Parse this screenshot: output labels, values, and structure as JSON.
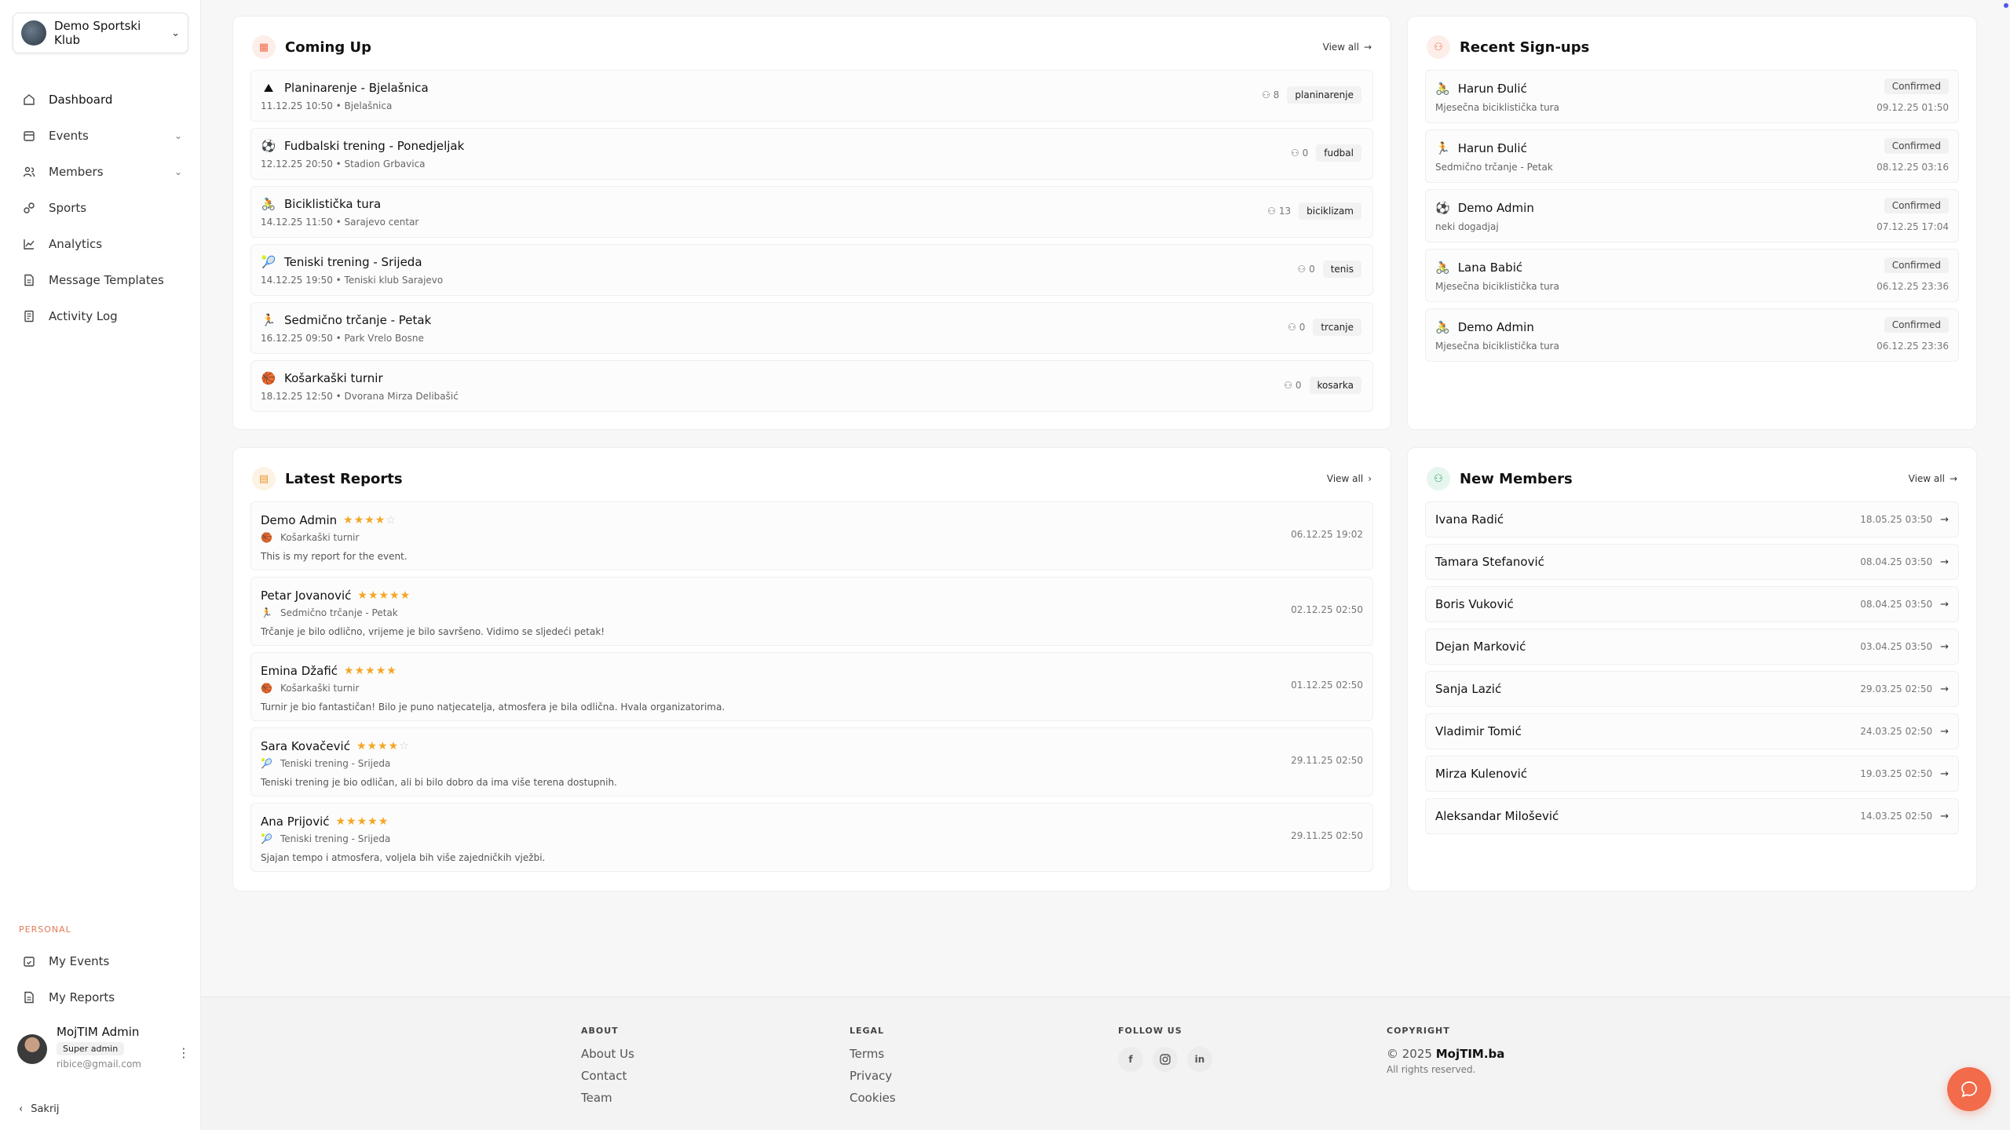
{
  "sidebar": {
    "club_name": "Demo Sportski Klub",
    "nav": [
      {
        "label": "Dashboard",
        "icon": "home-icon",
        "expandable": false
      },
      {
        "label": "Events",
        "icon": "calendar-icon",
        "expandable": true
      },
      {
        "label": "Members",
        "icon": "users-icon",
        "expandable": true
      },
      {
        "label": "Sports",
        "icon": "sports-icon",
        "expandable": false
      },
      {
        "label": "Analytics",
        "icon": "chart-icon",
        "expandable": false
      },
      {
        "label": "Message Templates",
        "icon": "document-icon",
        "expandable": false
      },
      {
        "label": "Activity Log",
        "icon": "log-icon",
        "expandable": false
      }
    ],
    "personal_label": "PERSONAL",
    "personal_nav": [
      {
        "label": "My Events",
        "icon": "calendar-check-icon"
      },
      {
        "label": "My Reports",
        "icon": "document-icon"
      }
    ],
    "user": {
      "name": "MojTIM Admin",
      "role": "Super admin",
      "email": "ribice@gmail.com"
    },
    "collapse_label": "Sakrij"
  },
  "coming_up": {
    "title": "Coming Up",
    "view_all": "View all",
    "events": [
      {
        "emoji": "⛰",
        "title": "Planinarenje - Bjelašnica",
        "sub": "11.12.25 10:50 • Bjelašnica",
        "count": "8",
        "tag": "planinarenje"
      },
      {
        "emoji": "⚽",
        "title": "Fudbalski trening - Ponedjeljak",
        "sub": "12.12.25 20:50 • Stadion Grbavica",
        "count": "0",
        "tag": "fudbal"
      },
      {
        "emoji": "🚴",
        "title": "Biciklistička tura",
        "sub": "14.12.25 11:50 • Sarajevo centar",
        "count": "13",
        "tag": "biciklizam"
      },
      {
        "emoji": "🎾",
        "title": "Teniski trening - Srijeda",
        "sub": "14.12.25 19:50 • Teniski klub Sarajevo",
        "count": "0",
        "tag": "tenis"
      },
      {
        "emoji": "🏃",
        "title": "Sedmično trčanje - Petak",
        "sub": "16.12.25 09:50 • Park Vrelo Bosne",
        "count": "0",
        "tag": "trcanje"
      },
      {
        "emoji": "🏀",
        "title": "Košarkaški turnir",
        "sub": "18.12.25 12:50 • Dvorana Mirza Delibašić",
        "count": "0",
        "tag": "kosarka"
      }
    ]
  },
  "recent_signups": {
    "title": "Recent Sign-ups",
    "items": [
      {
        "emoji": "🚴",
        "name": "Harun Đulić",
        "event": "Mjesečna biciklistička tura",
        "status": "Confirmed",
        "date": "09.12.25 01:50"
      },
      {
        "emoji": "🏃",
        "name": "Harun Đulić",
        "event": "Sedmično trčanje - Petak",
        "status": "Confirmed",
        "date": "08.12.25 03:16"
      },
      {
        "emoji": "⚽",
        "name": "Demo Admin",
        "event": "neki dogadjaj",
        "status": "Confirmed",
        "date": "07.12.25 17:04"
      },
      {
        "emoji": "🚴",
        "name": "Lana Babić",
        "event": "Mjesečna biciklistička tura",
        "status": "Confirmed",
        "date": "06.12.25 23:36"
      },
      {
        "emoji": "🚴",
        "name": "Demo Admin",
        "event": "Mjesečna biciklistička tura",
        "status": "Confirmed",
        "date": "06.12.25 23:36"
      }
    ]
  },
  "latest_reports": {
    "title": "Latest Reports",
    "view_all": "View all",
    "items": [
      {
        "name": "Demo Admin",
        "stars": "★★★★",
        "stars_off": "☆",
        "rating": 4,
        "emoji": "🏀",
        "event": "Košarkaški turnir",
        "text": "This is my report for the event.",
        "date": "06.12.25 19:02"
      },
      {
        "name": "Petar Jovanović",
        "stars": "★★★★★",
        "stars_off": "",
        "rating": 5,
        "emoji": "🏃",
        "event": "Sedmično trčanje - Petak",
        "text": "Trčanje je bilo odlično, vrijeme je bilo savršeno. Vidimo se sljedeći petak!",
        "date": "02.12.25 02:50"
      },
      {
        "name": "Emina Džafić",
        "stars": "★★★★★",
        "stars_off": "",
        "rating": 5,
        "emoji": "🏀",
        "event": "Košarkaški turnir",
        "text": "Turnir je bio fantastičan! Bilo je puno natjecatelja, atmosfera je bila odlična. Hvala organizatorima.",
        "date": "01.12.25 02:50"
      },
      {
        "name": "Sara Kovačević",
        "stars": "★★★★",
        "stars_off": "☆",
        "rating": 4,
        "emoji": "🎾",
        "event": "Teniski trening - Srijeda",
        "text": "Teniski trening je bio odličan, ali bi bilo dobro da ima više terena dostupnih.",
        "date": "29.11.25 02:50"
      },
      {
        "name": "Ana Prijović",
        "stars": "★★★★★",
        "stars_off": "",
        "rating": 5,
        "emoji": "🎾",
        "event": "Teniski trening - Srijeda",
        "text": "Sjajan tempo i atmosfera, voljela bih više zajedničkih vježbi.",
        "date": "29.11.25 02:50"
      }
    ]
  },
  "new_members": {
    "title": "New Members",
    "view_all": "View all",
    "items": [
      {
        "name": "Ivana Radić",
        "date": "18.05.25 03:50"
      },
      {
        "name": "Tamara Stefanović",
        "date": "08.04.25 03:50"
      },
      {
        "name": "Boris Vuković",
        "date": "08.04.25 03:50"
      },
      {
        "name": "Dejan Marković",
        "date": "03.04.25 03:50"
      },
      {
        "name": "Sanja Lazić",
        "date": "29.03.25 02:50"
      },
      {
        "name": "Vladimir Tomić",
        "date": "24.03.25 02:50"
      },
      {
        "name": "Mirza Kulenović",
        "date": "19.03.25 02:50"
      },
      {
        "name": "Aleksandar Milošević",
        "date": "14.03.25 02:50"
      }
    ]
  },
  "footer": {
    "about": {
      "head": "ABOUT",
      "links": [
        "About Us",
        "Contact",
        "Team"
      ]
    },
    "legal": {
      "head": "LEGAL",
      "links": [
        "Terms",
        "Privacy",
        "Cookies"
      ]
    },
    "follow": {
      "head": "FOLLOW US",
      "icons": [
        "facebook-icon",
        "instagram-icon",
        "linkedin-icon"
      ]
    },
    "copyright": {
      "head": "COPYRIGHT",
      "line_prefix": "© 2025",
      "brand": "MojTIM.ba",
      "rights": "All rights reserved."
    }
  },
  "colors": {
    "accent": "#f26b4a",
    "star": "#f5a623"
  }
}
